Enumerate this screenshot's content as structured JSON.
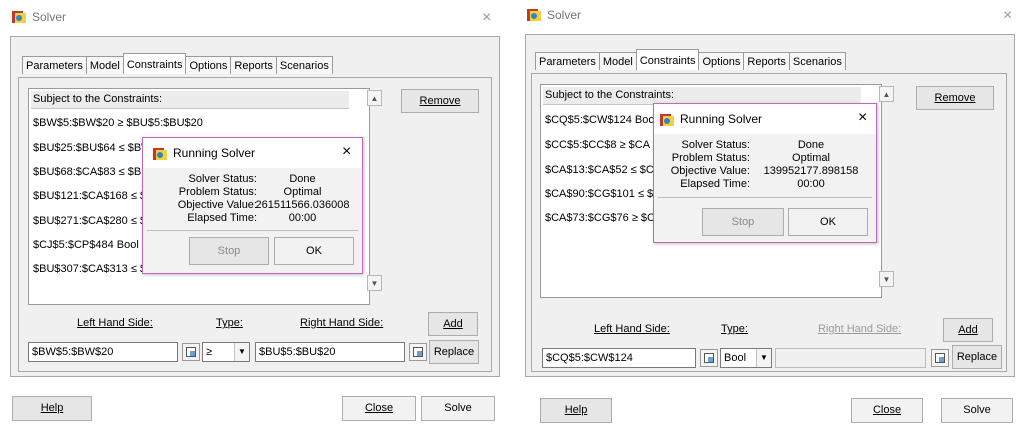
{
  "dialogs": [
    {
      "title": "Solver",
      "close": "×",
      "tabs": [
        "Parameters",
        "Model",
        "Constraints",
        "Options",
        "Reports",
        "Scenarios"
      ],
      "active_tab": "Constraints",
      "list_header": "Subject to the Constraints:",
      "constraints": [
        "$BW$5:$BW$20 ≥ $BU$5:$BU$20",
        "$BU$25:$BU$64 ≤ $BW",
        "$BU$68:$CA$83 ≤ $BU",
        "$BU$121:$CA$168 ≤ $E",
        "$BU$271:$CA$280 ≤ $E",
        "$CJ$5:$CP$484 Bool",
        "$BU$307:$CA$313 ≤ $E"
      ],
      "remove_label": "Remove",
      "lhs_label": "Left Hand Side:",
      "type_label": "Type:",
      "rhs_label": "Right Hand Side:",
      "add_label": "Add",
      "replace_label": "Replace",
      "lhs_value": "$BW$5:$BW$20",
      "type_value": "≥",
      "rhs_value": "$BU$5:$BU$20",
      "help_label": "Help",
      "close_label": "Close",
      "solve_label": "Solve",
      "popup": {
        "title": "Running Solver",
        "close": "×",
        "rows": [
          {
            "label": "Solver Status:",
            "value": "Done"
          },
          {
            "label": "Problem Status:",
            "value": "Optimal"
          },
          {
            "label": "Objective Value:",
            "value": "261511566.036008"
          },
          {
            "label": "Elapsed Time:",
            "value": "00:00"
          }
        ],
        "stop_label": "Stop",
        "ok_label": "OK"
      }
    },
    {
      "title": "Solver",
      "close": "×",
      "tabs": [
        "Parameters",
        "Model",
        "Constraints",
        "Options",
        "Reports",
        "Scenarios"
      ],
      "active_tab": "Constraints",
      "list_header": "Subject to the Constraints:",
      "constraints": [
        "$CQ$5:$CW$124 Boo",
        "$CC$5:$CC$8 ≥ $CA",
        "$CA$13:$CA$52 ≤ $C",
        "$CA$90:$CG$101 ≤ $",
        "$CA$73:$CG$76 ≥ $C"
      ],
      "remove_label": "Remove",
      "lhs_label": "Left Hand Side:",
      "type_label": "Type:",
      "rhs_label": "Right Hand Side:",
      "add_label": "Add",
      "replace_label": "Replace",
      "lhs_value": "$CQ$5:$CW$124",
      "type_value": "Bool",
      "rhs_value": "",
      "help_label": "Help",
      "close_label": "Close",
      "solve_label": "Solve",
      "popup": {
        "title": "Running Solver",
        "close": "×",
        "rows": [
          {
            "label": "Solver Status:",
            "value": "Done"
          },
          {
            "label": "Problem Status:",
            "value": "Optimal"
          },
          {
            "label": "Objective Value:",
            "value": "139952177.898158"
          },
          {
            "label": "Elapsed Time:",
            "value": "00:00"
          }
        ],
        "stop_label": "Stop",
        "ok_label": "OK"
      }
    }
  ]
}
